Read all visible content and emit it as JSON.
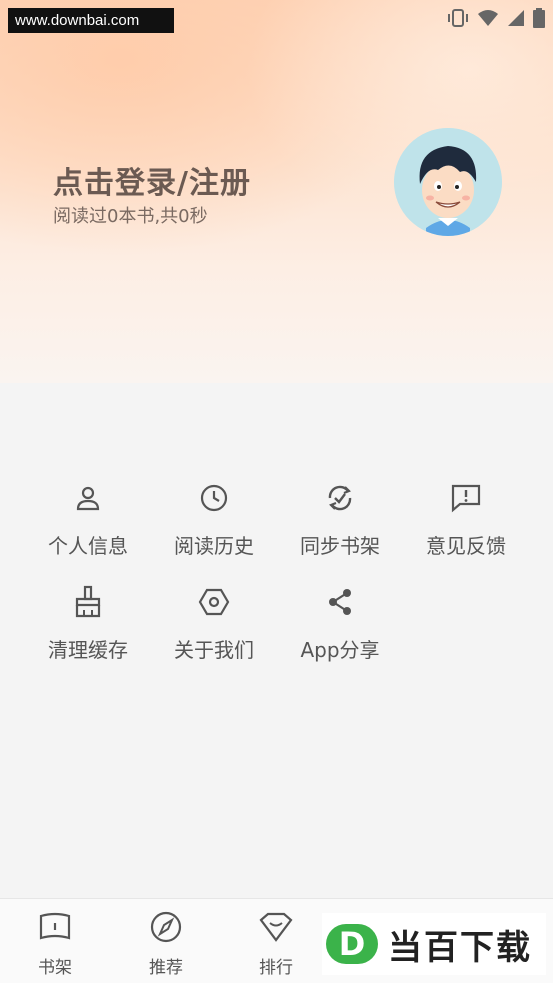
{
  "watermark": {
    "url": "www.downbai.com"
  },
  "status_bar": {
    "icons": [
      "vibrate-icon",
      "wifi-icon",
      "signal-icon",
      "battery-icon"
    ]
  },
  "profile": {
    "login_title": "点击登录/注册",
    "reading_stats": "阅读过0本书,共0秒"
  },
  "menu": {
    "items": [
      {
        "label": "个人信息",
        "icon": "user-icon"
      },
      {
        "label": "阅读历史",
        "icon": "clock-icon"
      },
      {
        "label": "同步书架",
        "icon": "sync-icon"
      },
      {
        "label": "意见反馈",
        "icon": "feedback-icon"
      },
      {
        "label": "清理缓存",
        "icon": "broom-icon"
      },
      {
        "label": "关于我们",
        "icon": "hex-nut-icon"
      },
      {
        "label": "App分享",
        "icon": "share-icon"
      }
    ]
  },
  "bottom_nav": {
    "items": [
      {
        "label": "书架",
        "icon": "book-icon"
      },
      {
        "label": "推荐",
        "icon": "compass-icon"
      },
      {
        "label": "排行",
        "icon": "ranking-icon"
      }
    ]
  },
  "brand_logo": {
    "badge": "D",
    "text": "当百下载",
    "color": "#3bb34a"
  }
}
